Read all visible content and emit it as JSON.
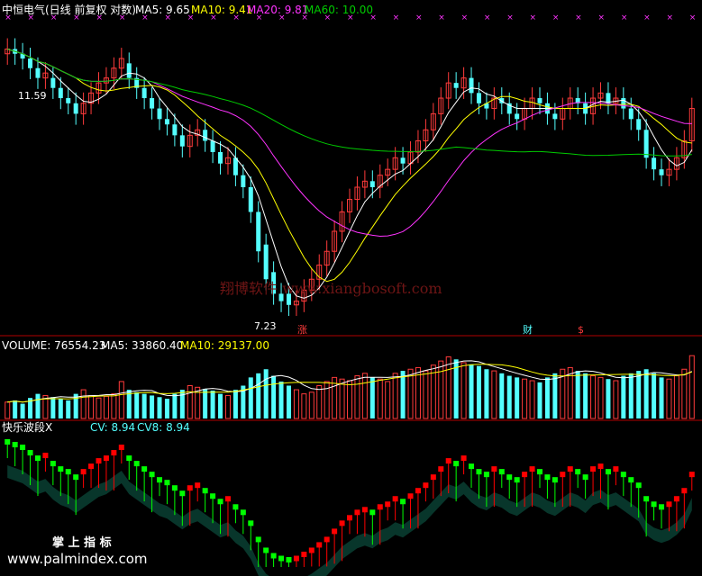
{
  "colors": {
    "background": "#000000",
    "up": "#ff3b3b",
    "down": "#54ffff",
    "ma5": "#ffffff",
    "ma10": "#ffff00",
    "ma20": "#ff33ff",
    "ma60": "#00cc00",
    "separator": "#b00000",
    "cv_up": "#ff0000",
    "cv_down": "#00ff00",
    "band": "#0f6b55"
  },
  "header": {
    "title": "中恒电气(日线 前复权 对数)",
    "ma5": "MA5: 9.65",
    "ma10": "MA10: 9.41",
    "ma20": "MA20: 9.81",
    "ma60": "MA60: 10.00"
  },
  "price_panel": {
    "high_label": "11.59",
    "low_label": "7.23",
    "watermark": "翔博软件 www.xiangbosoft.com",
    "markers": {
      "zhang": "涨",
      "cai": "财",
      "dollar": "$"
    }
  },
  "volume_panel": {
    "volume": "VOLUME: 76554.23",
    "ma5": "MA5: 33860.40",
    "ma10": "MA10: 29137.00"
  },
  "indicator_panel": {
    "name": "快乐波段X",
    "cv": "CV: 8.94",
    "cv8": "CV8: 8.94"
  },
  "footer": {
    "brand": "掌 上 指 标",
    "url": "www.palmindex.com"
  },
  "chart_data": [
    {
      "type": "candlestick",
      "title": "中恒电气(日线 前复权 对数)",
      "close": [
        11.6,
        11.5,
        11.4,
        11.2,
        11.0,
        11.1,
        10.8,
        10.6,
        10.5,
        10.3,
        10.5,
        10.7,
        10.9,
        11.0,
        11.2,
        11.4,
        11.0,
        10.8,
        10.6,
        10.4,
        10.2,
        10.1,
        9.9,
        9.7,
        9.9,
        10.0,
        9.8,
        9.6,
        9.4,
        9.5,
        9.2,
        9.0,
        8.6,
        8.0,
        7.6,
        7.4,
        7.3,
        7.25,
        7.3,
        7.45,
        7.6,
        7.8,
        8.0,
        8.3,
        8.6,
        8.8,
        9.0,
        9.1,
        9.0,
        9.2,
        9.3,
        9.5,
        9.4,
        9.6,
        9.8,
        10.0,
        10.3,
        10.6,
        10.9,
        10.8,
        11.0,
        10.7,
        10.5,
        10.4,
        10.6,
        10.5,
        10.3,
        10.2,
        10.4,
        10.6,
        10.5,
        10.3,
        10.2,
        10.4,
        10.6,
        10.5,
        10.3,
        10.6,
        10.7,
        10.5,
        10.6,
        10.4,
        10.2,
        10.0,
        9.5,
        9.3,
        9.2,
        9.3,
        9.5,
        9.8,
        10.4
      ],
      "open": [
        11.5,
        11.6,
        11.5,
        11.4,
        11.2,
        11.0,
        11.0,
        10.8,
        10.6,
        10.5,
        10.3,
        10.5,
        10.7,
        10.9,
        11.0,
        11.2,
        11.3,
        11.0,
        10.8,
        10.6,
        10.4,
        10.2,
        10.1,
        9.9,
        9.7,
        9.9,
        10.0,
        9.8,
        9.6,
        9.4,
        9.5,
        9.2,
        9.0,
        8.6,
        8.1,
        7.7,
        7.4,
        7.4,
        7.25,
        7.3,
        7.45,
        7.6,
        7.8,
        8.0,
        8.3,
        8.6,
        8.8,
        9.0,
        9.1,
        9.0,
        9.2,
        9.3,
        9.5,
        9.4,
        9.6,
        9.8,
        10.0,
        10.3,
        10.6,
        10.9,
        10.8,
        11.0,
        10.7,
        10.5,
        10.4,
        10.6,
        10.5,
        10.3,
        10.2,
        10.4,
        10.6,
        10.5,
        10.3,
        10.2,
        10.4,
        10.6,
        10.5,
        10.3,
        10.6,
        10.7,
        10.5,
        10.6,
        10.4,
        10.2,
        10.0,
        9.5,
        9.3,
        9.2,
        9.3,
        9.5,
        9.8
      ],
      "ma": {
        "MA5": 9.65,
        "MA10": 9.41,
        "MA20": 9.81,
        "MA60": 10.0
      },
      "labels": [
        "11.59",
        "7.23"
      ]
    },
    {
      "type": "bar",
      "title": "VOLUME",
      "values": [
        20,
        22,
        18,
        25,
        30,
        28,
        26,
        24,
        22,
        30,
        35,
        28,
        25,
        27,
        30,
        45,
        35,
        32,
        30,
        28,
        26,
        24,
        30,
        35,
        40,
        38,
        36,
        34,
        30,
        28,
        35,
        40,
        50,
        55,
        60,
        52,
        45,
        40,
        35,
        30,
        32,
        40,
        45,
        50,
        48,
        46,
        52,
        55,
        50,
        48,
        45,
        55,
        58,
        60,
        62,
        58,
        65,
        70,
        75,
        72,
        68,
        66,
        64,
        60,
        58,
        55,
        52,
        50,
        48,
        46,
        44,
        50,
        55,
        60,
        62,
        58,
        55,
        52,
        50,
        48,
        46,
        52,
        55,
        58,
        60,
        55,
        50,
        48,
        52,
        60,
        76.5
      ],
      "series": [
        {
          "name": "MA5",
          "value": 33860.4
        },
        {
          "name": "MA10",
          "value": 29137.0
        }
      ]
    },
    {
      "type": "bar",
      "title": "快乐波段X",
      "series": [
        {
          "name": "CV",
          "value": 8.94
        },
        {
          "name": "CV8",
          "value": 8.94
        }
      ]
    }
  ]
}
